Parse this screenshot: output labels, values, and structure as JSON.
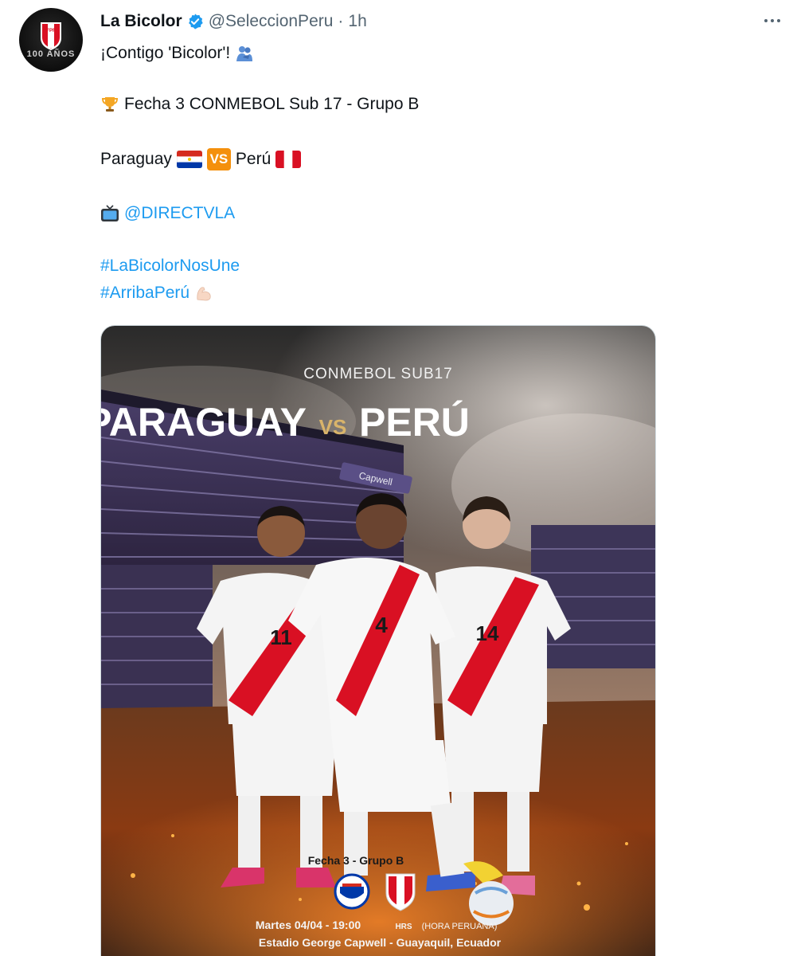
{
  "author": {
    "name": "La Bicolor",
    "handle": "@SeleccionPeru",
    "separator": "·",
    "time": "1h",
    "avatar_text": "100 AÑOS",
    "verified_icon": "verified-badge-icon"
  },
  "tweet": {
    "line1": "¡Contigo 'Bicolor'!",
    "line2": "Fecha 3 CONMEBOL Sub 17 - Grupo B",
    "team_home": "Paraguay",
    "vs_badge": "VS",
    "team_away": "Perú",
    "broadcast_mention": "@DIRECTVLA",
    "hashtag1": "#LaBicolorNosUne",
    "hashtag2": "#ArribaPerú"
  },
  "poster": {
    "tournament": "CONMEBOL SUB17",
    "home": "PARAGUAY",
    "vs": "VS",
    "away": "PERÚ",
    "stadium_sign": "Capwell",
    "player_numbers": [
      "11",
      "4",
      "14"
    ],
    "round": "Fecha 3  -  Grupo B",
    "date_time": "Martes 04/04 - 19:00",
    "hrs": "HRS",
    "timezone": "(HORA PERUANA)",
    "venue": "Estadio George Capwell - Guayaquil, Ecuador"
  },
  "colors": {
    "link": "#1d9bf0",
    "verified": "#1d9bf0",
    "peru_red": "#d91023",
    "paraguay_blue": "#0038a8",
    "vs_orange": "#f4900c",
    "gold": "#d9b46a"
  }
}
